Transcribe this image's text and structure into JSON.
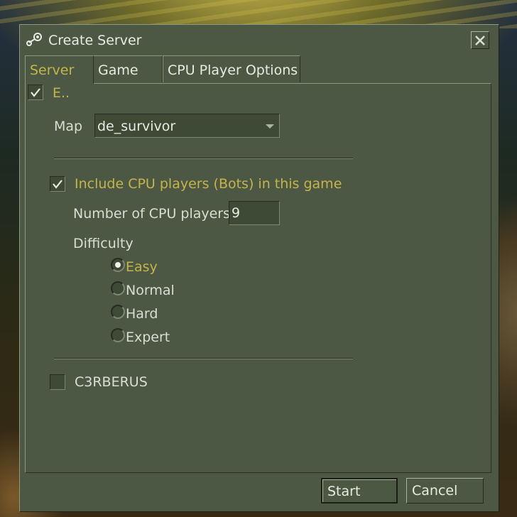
{
  "window": {
    "title": "Create Server",
    "close_icon": "close-icon"
  },
  "tabs": [
    {
      "label": "Server",
      "active": true
    },
    {
      "label": "Game",
      "active": false
    },
    {
      "label": "CPU Player Options",
      "active": false
    }
  ],
  "server_tab": {
    "enable_checkbox": {
      "label": "E..",
      "checked": true
    },
    "map": {
      "label": "Map",
      "value": "de_survivor"
    },
    "bots": {
      "include_label": "Include CPU players (Bots) in this game",
      "include_checked": true,
      "count_label": "Number of CPU players",
      "count_value": "9",
      "difficulty_label": "Difficulty",
      "difficulty_options": [
        {
          "label": "Easy",
          "selected": true
        },
        {
          "label": "Normal",
          "selected": false
        },
        {
          "label": "Hard",
          "selected": false
        },
        {
          "label": "Expert",
          "selected": false
        }
      ]
    },
    "c3rberus": {
      "label": "C3RBERUS",
      "checked": false
    }
  },
  "buttons": {
    "start": "Start",
    "cancel": "Cancel"
  },
  "colors": {
    "window_bg": "#4c5844",
    "active_text": "#c4b54a",
    "text": "#d8ded3",
    "field_bg": "#3e4936"
  }
}
